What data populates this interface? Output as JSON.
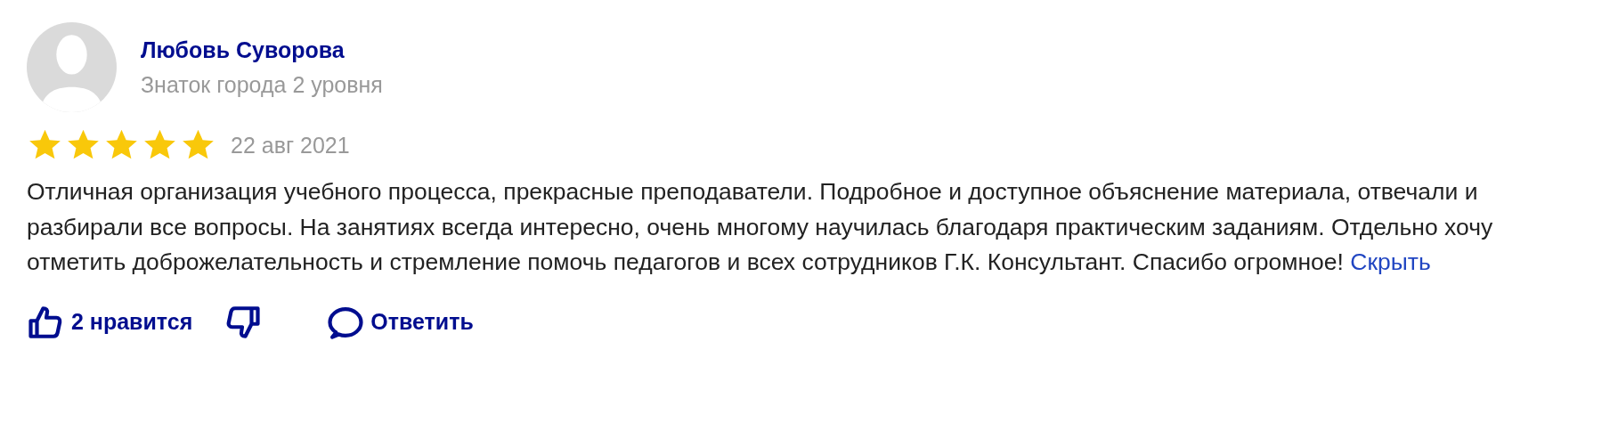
{
  "review": {
    "author": "Любовь Суворова",
    "author_level": "Знаток города 2 уровня",
    "stars": 5,
    "date": "22 авг 2021",
    "text": "Отличная организация учебного процесса, прекрасные преподаватели. Подробное и доступное объяснение материала, отвечали и разбирали все вопросы. На занятиях всегда интересно, очень многому научилась благодаря практическим заданиям. Отдельно хочу отметить доброжелательность и стремление помочь педагогов и всех сотрудников Г.К. Консультант. Спасибо огромное!",
    "collapse_link": "Скрыть"
  },
  "actions": [
    {
      "kind": "like",
      "label": "2 нравится"
    },
    {
      "kind": "dislike"
    },
    {
      "kind": "reply",
      "label": "Ответить"
    }
  ]
}
